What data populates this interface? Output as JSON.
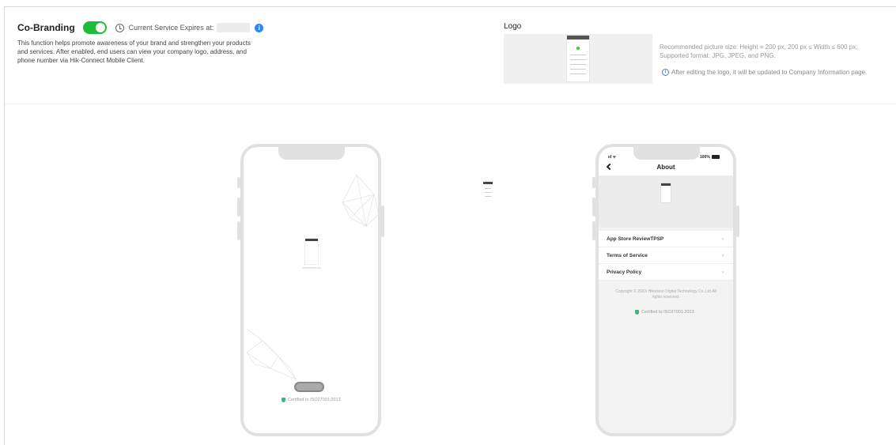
{
  "cobranding": {
    "title": "Co-Branding",
    "toggle_on": true,
    "expires_label": "Current Service Expires at:",
    "info_icon": "info-icon",
    "description": "This function helps promote awareness of your brand and strengthen your products and services. After enabled, end users can view your company logo, address, and phone number via Hik-Connect Mobile Client."
  },
  "logo": {
    "label": "Logo",
    "hint_size": "Recommended picture size: Height = 200 px, 200 px ≤ Width ≤ 600 px.",
    "hint_format": "Supported format: JPG, JPEG, and PNG.",
    "note": "After editing the logo, it will be updated to Company Information page."
  },
  "splash_phone": {
    "cert_text": "Certified to ISO27001:2013"
  },
  "about_phone": {
    "status_signal": "ııl ᯤ",
    "status_battery": "100%",
    "title": "About",
    "menu": [
      {
        "label": "App Store ReviewTPSP"
      },
      {
        "label": "Terms of Service"
      },
      {
        "label": "Privacy Policy"
      }
    ],
    "copyright": "Copyright © 20XX Hikvision Digital Technology Co.,Ltd All rights reserved.",
    "cert_text": "Certified to ISO27001:2013"
  },
  "colors": {
    "toggle": "#1fbb3b",
    "accent": "#2f86f6",
    "shield": "#3fb87f"
  }
}
